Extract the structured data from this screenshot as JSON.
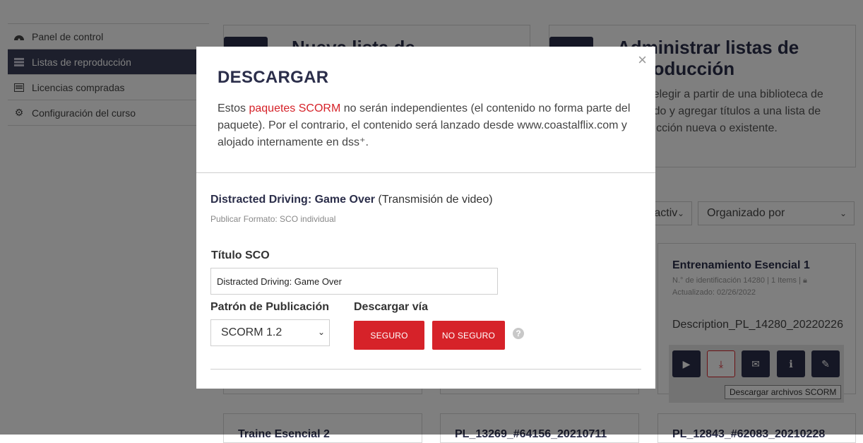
{
  "sidebar": {
    "items": [
      {
        "label": "Panel de control",
        "icon": "dashboard-icon"
      },
      {
        "label": "Listas de reproducción",
        "icon": "list-icon"
      },
      {
        "label": "Licencias compradas",
        "icon": "document-icon"
      },
      {
        "label": "Configuración del curso",
        "icon": "gear-icon"
      }
    ]
  },
  "hero_cards": [
    {
      "title": "Nueva lista de"
    },
    {
      "title": "Administrar listas de reproducción",
      "description": "Puede elegir a partir de una biblioteca de contenido y agregar títulos a una lista de reproducción nueva o existente."
    }
  ],
  "filters": {
    "status_partial": "a activ",
    "sort_label": "Organizado por"
  },
  "playlist": {
    "title": "Entrenamiento Esencial 1",
    "meta": "N.° de identificación 14280 | 1 Items |",
    "updated": "Actualizado: 02/26/2022",
    "description": "Description_PL_14280_20220226",
    "tooltip": "Descargar archivos SCORM"
  },
  "bottom_cards": [
    {
      "title": "Traine Esencial 2"
    },
    {
      "title": "PL_13269_#64156_20210711"
    },
    {
      "title": "PL_12843_#62083_20210228"
    }
  ],
  "modal": {
    "title": "DESCARGAR",
    "intro_before": "Estos ",
    "intro_link": "paquetes SCORM",
    "intro_after": " no serán independientes (el contenido no forma parte del paquete). Por el contrario, el contenido será lanzado desde www.coastalflix.com y alojado internamente en dss⁺.",
    "video_title": "Distracted Driving: Game Over",
    "video_type": "(Transmisión de video)",
    "format_label": "Publicar Formato:",
    "format_value": "SCO individual",
    "sco_title_label": "Título SCO",
    "sco_title_value": "Distracted Driving: Game Over",
    "pattern_label": "Patrón de Publicación",
    "pattern_value": "SCORM 1.2",
    "download_via_label": "Descargar vía",
    "secure_button": "SEGURO",
    "insecure_button": "NO SEGURO",
    "help_symbol": "?",
    "close_symbol": "×"
  },
  "colors": {
    "brand_navy": "#2b2e4a",
    "accent_red": "#d62229"
  }
}
